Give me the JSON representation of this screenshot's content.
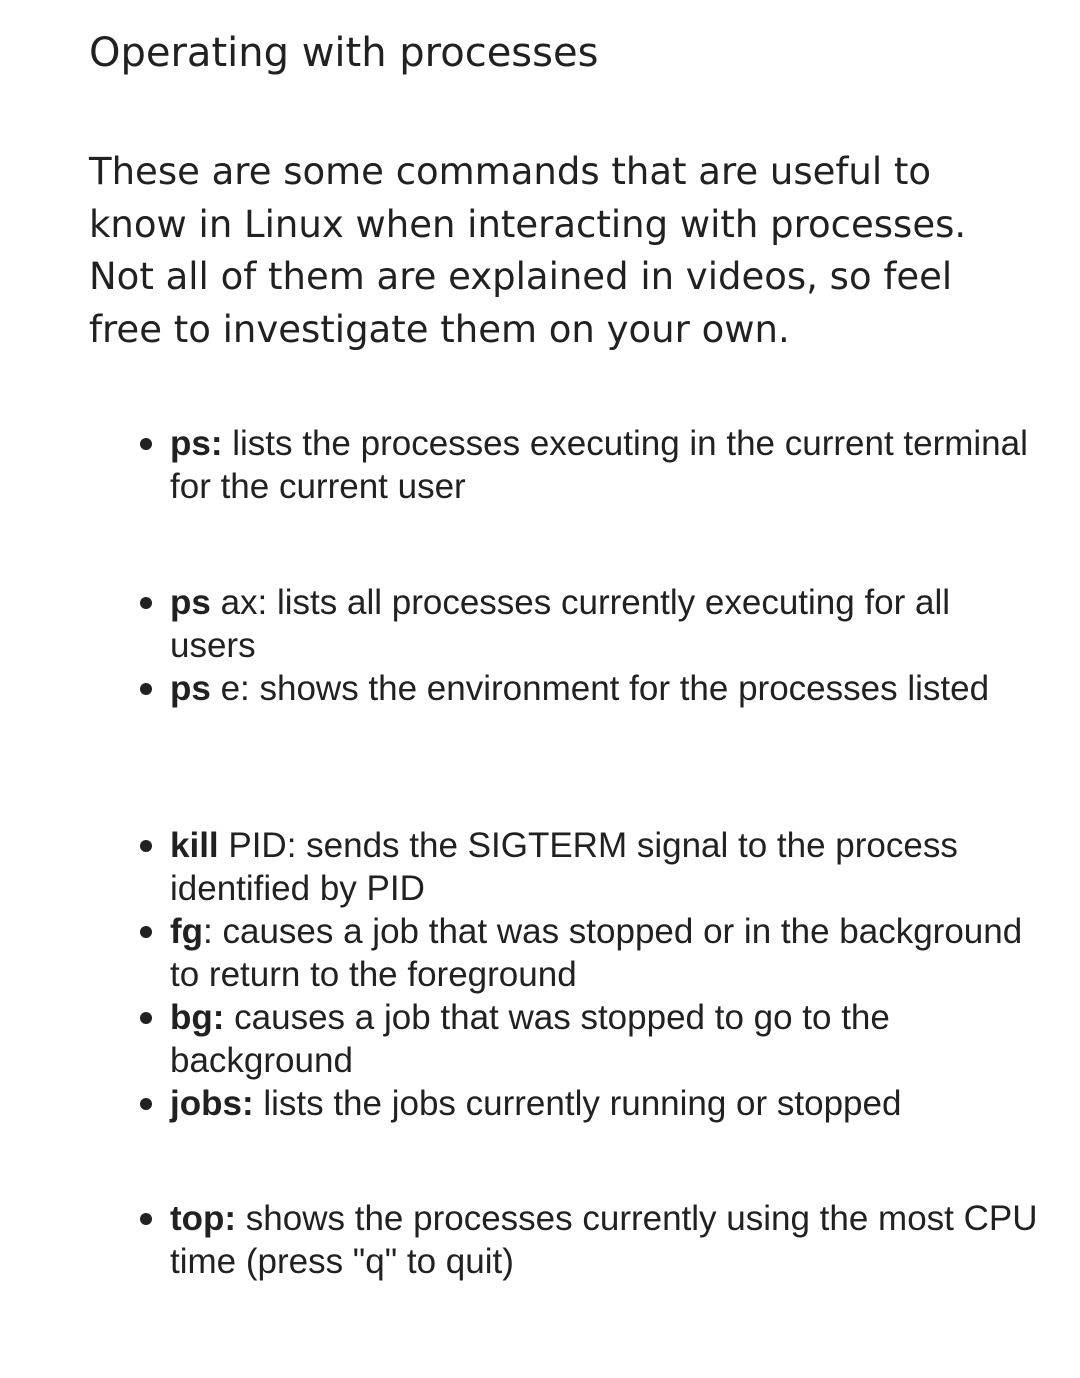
{
  "page": {
    "title": "Operating with processes",
    "intro": "These are some commands that are useful to know in Linux when interacting with processes. Not all of them are explained in videos, so feel free to investigate them on your own."
  },
  "groups": [
    {
      "items": [
        {
          "cmd": "ps:",
          "desc": " lists the processes executing in the current terminal for the current user"
        }
      ]
    },
    {
      "items": [
        {
          "cmd": "ps",
          "desc": " ax: lists all processes currently executing for all users"
        },
        {
          "cmd": "ps",
          "desc": " e: shows the environment for the processes listed"
        }
      ]
    },
    {
      "items": [
        {
          "cmd": "kill",
          "desc": " PID: sends the SIGTERM signal to the process identified by PID"
        },
        {
          "cmd": "fg",
          "desc": ": causes a job that was stopped or in the background to return to the foreground"
        },
        {
          "cmd": "bg:",
          "desc": " causes a job that was stopped to go to the background"
        },
        {
          "cmd": "jobs:",
          "desc": " lists the jobs currently running or stopped"
        }
      ]
    },
    {
      "items": [
        {
          "cmd": "top:",
          "desc": " shows the processes currently using the most CPU time (press \"q\" to quit)"
        }
      ]
    }
  ]
}
